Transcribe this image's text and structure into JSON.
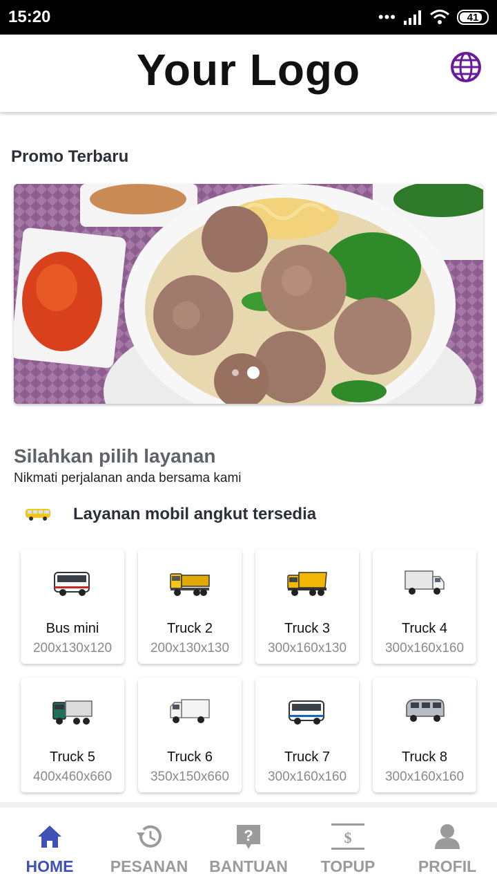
{
  "status_bar": {
    "time": "15:20",
    "battery": "41"
  },
  "header": {
    "logo_text": "Your Logo",
    "language_icon": "globe-icon"
  },
  "promo": {
    "title": "Promo Terbaru",
    "slides": 2,
    "active_slide": 2
  },
  "services": {
    "title": "Silahkan pilih layanan",
    "subtitle": "Nikmati perjalanan anda bersama kami",
    "available_label": "Layanan mobil angkut tersedia",
    "items": [
      {
        "name": "Bus mini",
        "size": "200x130x120",
        "icon": "bus-icon",
        "color": "#ffffff"
      },
      {
        "name": "Truck 2",
        "size": "200x130x130",
        "icon": "truck-icon",
        "color": "#f5c518"
      },
      {
        "name": "Truck 3",
        "size": "300x160x130",
        "icon": "dump-truck-icon",
        "color": "#f2b705"
      },
      {
        "name": "Truck 4",
        "size": "300x160x160",
        "icon": "box-truck-icon",
        "color": "#e8e8e8"
      },
      {
        "name": "Truck 5",
        "size": "400x460x660",
        "icon": "container-truck-icon",
        "color": "#1f6f5a"
      },
      {
        "name": "Truck 6",
        "size": "350x150x660",
        "icon": "box-truck-icon",
        "color": "#f4f4f4"
      },
      {
        "name": "Truck 7",
        "size": "300x160x160",
        "icon": "bus-icon",
        "color": "#ffffff"
      },
      {
        "name": "Truck 8",
        "size": "300x160x160",
        "icon": "van-icon",
        "color": "#b8bcc4"
      }
    ]
  },
  "bottom_nav": [
    {
      "label": "HOME",
      "icon": "home-icon",
      "active": true
    },
    {
      "label": "PESANAN",
      "icon": "history-icon",
      "active": false
    },
    {
      "label": "BANTUAN",
      "icon": "help-icon",
      "active": false
    },
    {
      "label": "TOPUP",
      "icon": "topup-icon",
      "active": false
    },
    {
      "label": "PROFIL",
      "icon": "profile-icon",
      "active": false
    }
  ],
  "colors": {
    "accent": "#3f51b5",
    "inactive": "#9b9b9b",
    "globe": "#6a1b9a"
  }
}
